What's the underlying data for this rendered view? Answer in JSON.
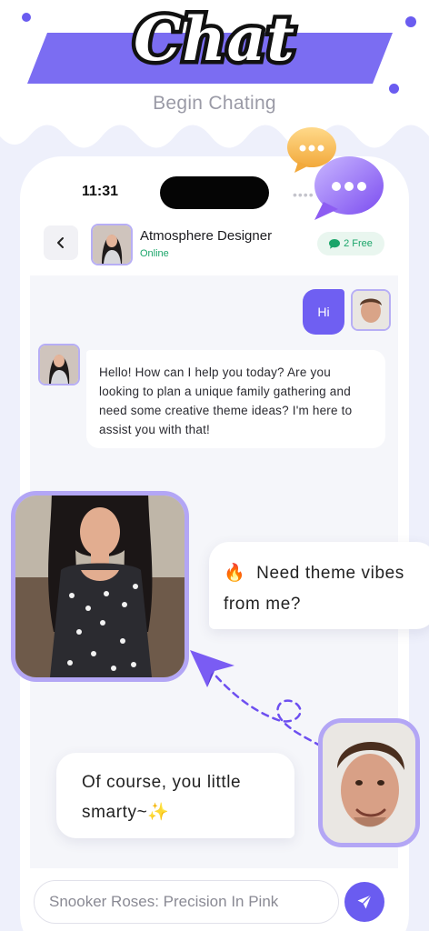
{
  "hero": {
    "title": "Chat",
    "subtitle": "Begin Chating"
  },
  "status_bar": {
    "time": "11:31",
    "dots": "••••"
  },
  "header": {
    "contact_name": "Atmosphere Designer",
    "contact_status": "Online",
    "free_badge": "2 Free"
  },
  "messages": {
    "user_hi": "Hi",
    "bot_reply": "Hello! How can I help you today? Are you looking to plan a unique family gathering and need some creative theme ideas? I'm here to assist you with that!"
  },
  "floating": {
    "bubble_1_emoji": "🔥",
    "bubble_1_text": "Need theme vibes from me?",
    "bubble_2_text": "Of course, you little smarty~",
    "bubble_2_emoji": "✨"
  },
  "composer": {
    "placeholder": "Snooker Roses: Precision In Pink"
  },
  "colors": {
    "accent": "#6a5cf0",
    "online_green": "#1ba56a",
    "photo_border": "#b3a6f5",
    "background": "#eef0fb"
  },
  "icons": {
    "back": "chevron-left-icon",
    "badge": "chat-bubble-icon",
    "send": "paper-plane-icon",
    "decor_1": "yellow-chat-bubble-icon",
    "decor_2": "purple-chat-bubble-icon",
    "decor_3": "paper-airplane-icon"
  }
}
